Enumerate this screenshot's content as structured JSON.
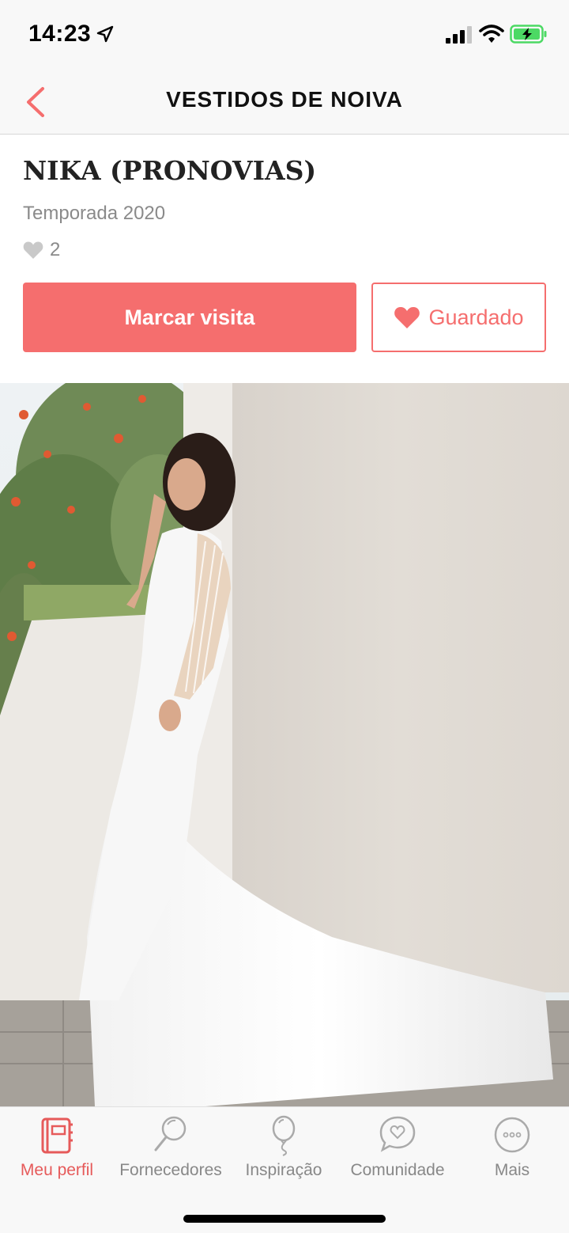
{
  "status": {
    "time": "14:23"
  },
  "header": {
    "title": "VESTIDOS DE NOIVA"
  },
  "product": {
    "name": "NIKA (PRONOVIAS)",
    "season": "Temporada 2020",
    "likes": "2"
  },
  "actions": {
    "visit_label": "Marcar visita",
    "saved_label": "Guardado"
  },
  "tabs": [
    {
      "label": "Meu perfil",
      "icon": "profile-notebook-icon",
      "active": true
    },
    {
      "label": "Fornecedores",
      "icon": "magnifier-icon",
      "active": false
    },
    {
      "label": "Inspiração",
      "icon": "balloon-icon",
      "active": false
    },
    {
      "label": "Comunidade",
      "icon": "chat-heart-icon",
      "active": false
    },
    {
      "label": "Mais",
      "icon": "more-dots-icon",
      "active": false
    }
  ],
  "colors": {
    "accent": "#f56e6e",
    "tab_active": "#e65a5a",
    "tab_inactive": "#888888",
    "battery": "#4cd964"
  }
}
